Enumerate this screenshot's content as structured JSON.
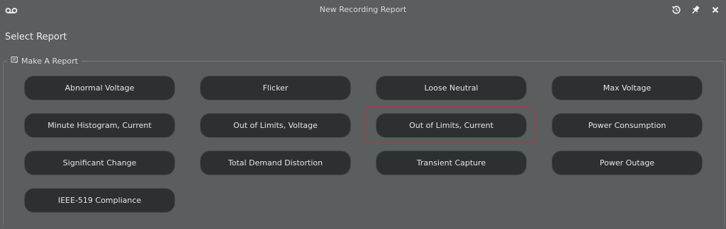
{
  "window": {
    "title": "New Recording Report",
    "logo_icon": "voicemail-icon",
    "buttons": [
      {
        "name": "history-button",
        "icon": "history-icon"
      },
      {
        "name": "pin-button",
        "icon": "pin-icon"
      },
      {
        "name": "close-button",
        "icon": "close-icon"
      }
    ]
  },
  "page": {
    "heading": "Select Report"
  },
  "group": {
    "legend": "Make A Report",
    "legend_icon": "report-icon",
    "reports": [
      "Abnormal Voltage",
      "Flicker",
      "Loose Neutral",
      "Max Voltage",
      "Minute Histogram, Current",
      "Out of Limits, Voltage",
      "Out of Limits, Current",
      "Power Consumption",
      "Significant Change",
      "Total Demand Distortion",
      "Transient Capture",
      "Power Outage",
      "IEEE-519 Compliance"
    ],
    "selected_report": "Out of Limits, Current"
  },
  "colors": {
    "background": "#5a5e5e",
    "button": "#2d3030",
    "selection": "#b4363c"
  }
}
